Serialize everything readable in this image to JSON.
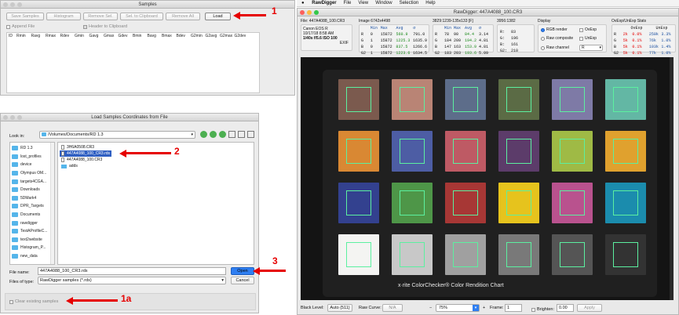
{
  "samples_window": {
    "title": "Samples",
    "buttons": {
      "save": "Save Samples",
      "histogram": "Histogram",
      "remove": "Remove Sel.",
      "clipboard": "Sel. to Clipboard",
      "remove_all": "Remove All",
      "load": "Load"
    },
    "append_label": "Append File",
    "header_label": "Header to Clipboard",
    "columns": [
      "ID",
      "Rmin",
      "Ravg",
      "Rmax",
      "Rdev",
      "Gmin",
      "Gavg",
      "Gmax",
      "Gdev",
      "Bmin",
      "Bavg",
      "Bmax",
      "Bdev",
      "G2min",
      "G2avg",
      "G2max",
      "G2dev"
    ]
  },
  "load_dialog": {
    "title": "Load Samples Coordinates from File",
    "look_in_label": "Look in:",
    "look_in_value": "/Volumes/Documents/RD 1.3",
    "sidebar": [
      "RD 1.3",
      "lost_profiles",
      "device",
      "Olympus OM...",
      "targets4CGA...",
      "Downloads",
      "5DMark4",
      "DPR_Targets",
      "Documents",
      "rawdigger",
      "TestAProfileC...",
      "text2website",
      "Histogram_P...",
      "new_data"
    ],
    "files": [
      "3H6A0508.CR3",
      "447A4088_100_CR3.rds",
      "447A4088_100.CR3",
      "adds"
    ],
    "file_name_label": "File name:",
    "file_name_value": "447A4088_100_CR3.rds",
    "files_of_type_label": "Files of type:",
    "files_of_type_value": "RawDigger samples (*.rds)",
    "open_label": "Open",
    "cancel_label": "Cancel",
    "clear_label": "Clear existing samples"
  },
  "annotations": {
    "a1": "1",
    "a2": "2",
    "a3": "3",
    "a1a": "1a"
  },
  "menubar": {
    "apple": "",
    "items": [
      "RawDigger",
      "File",
      "View",
      "Window",
      "Selection",
      "Help"
    ]
  },
  "rd_window": {
    "title": "RawDigger: 447A4088_100.CR3",
    "file_info": {
      "file_line": "File: 447A4088_100.CR3",
      "camera": "Canon EOS R",
      "date": "10/17/18 8:58 AM",
      "exposure": "1/40s f/5.6 ISO 100",
      "exif": "EXIF"
    },
    "image_stats": {
      "header": "Image 6742x4498",
      "cols": [
        "Min",
        "Max",
        "Avg",
        "σ"
      ],
      "rows": [
        {
          "ch": "R",
          "min": "0",
          "max": "15872",
          "avg": "560.9",
          "sd": "791.0"
        },
        {
          "ch": "G",
          "min": "1",
          "max": "15872",
          "avg": "1225.3",
          "sd": "1635.9"
        },
        {
          "ch": "B",
          "min": "0",
          "max": "15872",
          "avg": "837.5",
          "sd": "1266.6"
        },
        {
          "ch": "G2",
          "min": "1",
          "max": "15872",
          "avg": "1223.6",
          "sd": "1634.5"
        }
      ]
    },
    "sel_stats": {
      "header": "3829:1239-135x133 [F]",
      "rows": [
        {
          "ch": "R",
          "min": "78",
          "max": "90",
          "avg": "84.4",
          "sd": "3.14"
        },
        {
          "ch": "G",
          "min": "184",
          "max": "209",
          "avg": "194.2",
          "sd": "4.81"
        },
        {
          "ch": "B",
          "min": "147",
          "max": "163",
          "avg": "153.9",
          "sd": "4.81"
        },
        {
          "ch": "G2",
          "min": "183",
          "max": "203",
          "avg": "193.6",
          "sd": "5.09"
        }
      ]
    },
    "pixel": {
      "header": "3956:1382",
      "rows": [
        {
          "ch": "R:",
          "v": "83"
        },
        {
          "ch": "G:",
          "v": "196"
        },
        {
          "ch": "B:",
          "v": "161"
        },
        {
          "ch": "G2:",
          "v": "210"
        }
      ]
    },
    "display": {
      "header": "Display",
      "options": [
        "RGB render",
        "Raw composite",
        "Raw channel"
      ],
      "selected": "RGB render",
      "channel_value": "R",
      "ovexp": "OvExp",
      "unexp": "UnExp"
    },
    "ovexp_stats": {
      "header": "OvExp/UnExp Stats",
      "cols": [
        "OvExp",
        "UnExp"
      ],
      "rows": [
        {
          "ch": "R",
          "o1": "2k",
          "o2": "0.0%",
          "u1": "250k",
          "u2": "3.3%"
        },
        {
          "ch": "G",
          "o1": "5k",
          "o2": "0.1%",
          "u1": "76k",
          "u2": "1.0%"
        },
        {
          "ch": "B",
          "o1": "5k",
          "o2": "0.1%",
          "u1": "103k",
          "u2": "1.4%"
        },
        {
          "ch": "G2",
          "o1": "5k",
          "o2": "0.1%",
          "u1": "77k",
          "u2": "1.0%"
        }
      ]
    },
    "chart_text": "x·rite ColorChecker® Color Rendition Chart",
    "bottom": {
      "black_level_label": "Black Level:",
      "black_level_value": "Auto (511)",
      "raw_curve_label": "Raw Curve:",
      "raw_curve_value": "N/A",
      "zoom_value": "75%",
      "frame_label": "Frame:",
      "frame_value": "1",
      "brighten_label": "Brighten:",
      "brighten_value": "0.00",
      "apply_label": "Apply"
    }
  },
  "colors": {
    "patches": [
      "#7b5a4e",
      "#b98475",
      "#5d6d8a",
      "#5b6b45",
      "#7e7aa6",
      "#63b7a4",
      "#d98833",
      "#4d5da4",
      "#be5a64",
      "#5c3c6a",
      "#9fba45",
      "#e0a12e",
      "#33418f",
      "#4e9648",
      "#a73735",
      "#e6c31d",
      "#b9528e",
      "#1b8cad",
      "#f4f4f2",
      "#c8c8c8",
      "#a0a0a0",
      "#797979",
      "#555555",
      "#333333"
    ],
    "annotation_red": "#e60000",
    "open_blue": "#2f7ff2"
  }
}
